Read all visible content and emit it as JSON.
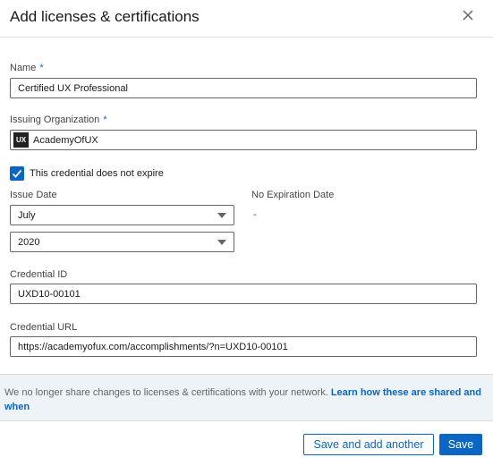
{
  "header": {
    "title": "Add licenses & certifications",
    "close_icon": "close-icon"
  },
  "form": {
    "name": {
      "label": "Name",
      "required": "*",
      "value": "Certified UX Professional"
    },
    "org": {
      "label": "Issuing Organization",
      "required": "*",
      "value": "AcademyOfUX",
      "logo_text": "UX"
    },
    "no_expire": {
      "label": "This credential does not expire",
      "checked": true
    },
    "issue_date": {
      "label": "Issue Date",
      "month": "July",
      "year": "2020"
    },
    "expiration": {
      "label": "No Expiration Date",
      "value": "-"
    },
    "credential_id": {
      "label": "Credential ID",
      "value": "UXD10-00101"
    },
    "credential_url": {
      "label": "Credential URL",
      "value": "https://academyofux.com/accomplishments/?n=UXD10-00101"
    }
  },
  "notice": {
    "text": "We no longer share changes to licenses & certifications with your network. ",
    "link": "Learn how these are shared and when"
  },
  "footer": {
    "save_another": "Save and add another",
    "save": "Save"
  },
  "colors": {
    "accent": "#0a66c2",
    "notice_bg": "#eef3f8"
  }
}
